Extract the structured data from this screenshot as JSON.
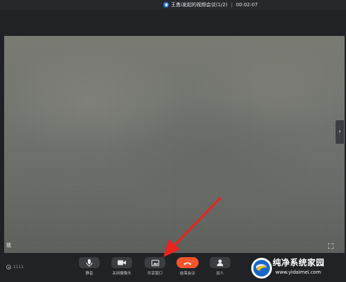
{
  "window": {
    "title": "王勇i发起的视频会议(1/2)",
    "separator": "|",
    "timer": "00:02:07"
  },
  "video": {
    "self_label": "我",
    "side_tab_icon": "chevron-right-icon",
    "fullscreen_icon": "fullscreen-icon"
  },
  "toolbar": {
    "network_label": "1111",
    "controls": [
      {
        "id": "mute",
        "label": "静音",
        "icon": "microphone-icon"
      },
      {
        "id": "camera",
        "label": "关闭摄像头",
        "icon": "camera-icon"
      },
      {
        "id": "share",
        "label": "共享窗口",
        "icon": "share-screen-icon"
      },
      {
        "id": "end",
        "label": "结束会议",
        "icon": "hang-up-icon",
        "color": "#f2552c"
      },
      {
        "id": "join",
        "label": "加人",
        "icon": "add-person-icon"
      }
    ]
  },
  "annotation": {
    "arrow_color": "#e8241f"
  },
  "watermark": {
    "text": "纯净系统家园",
    "url": "www.yidaimei.com"
  }
}
